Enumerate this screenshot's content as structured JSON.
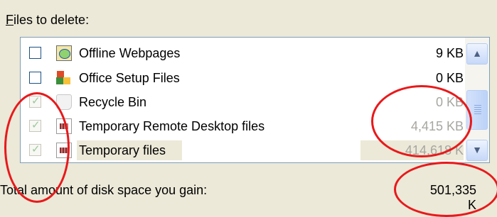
{
  "files_label": "Files to delete:",
  "files_label_mnemonic": "F",
  "files_label_rest": "iles to delete:",
  "items": [
    {
      "name": "Offline Webpages",
      "size": "9 KB",
      "checked": false,
      "icon": "offline-webpages-icon"
    },
    {
      "name": "Office Setup Files",
      "size": "0 KB",
      "checked": false,
      "icon": "office-setup-icon"
    },
    {
      "name": "Recycle Bin",
      "size": "0 KB",
      "checked": true,
      "icon": "recycle-bin-icon"
    },
    {
      "name": "Temporary Remote Desktop files",
      "size": "4,415 KB",
      "checked": true,
      "icon": "remote-desktop-files-icon"
    },
    {
      "name": "Temporary files",
      "size": "414,618 K",
      "checked": true,
      "icon": "temporary-files-icon"
    }
  ],
  "total": {
    "label": "Total amount of disk space you gain:",
    "value": "501,335 K"
  },
  "colors": {
    "annotation": "#e8191b",
    "window_bg": "#ece9d8",
    "list_border": "#7f9db9"
  }
}
